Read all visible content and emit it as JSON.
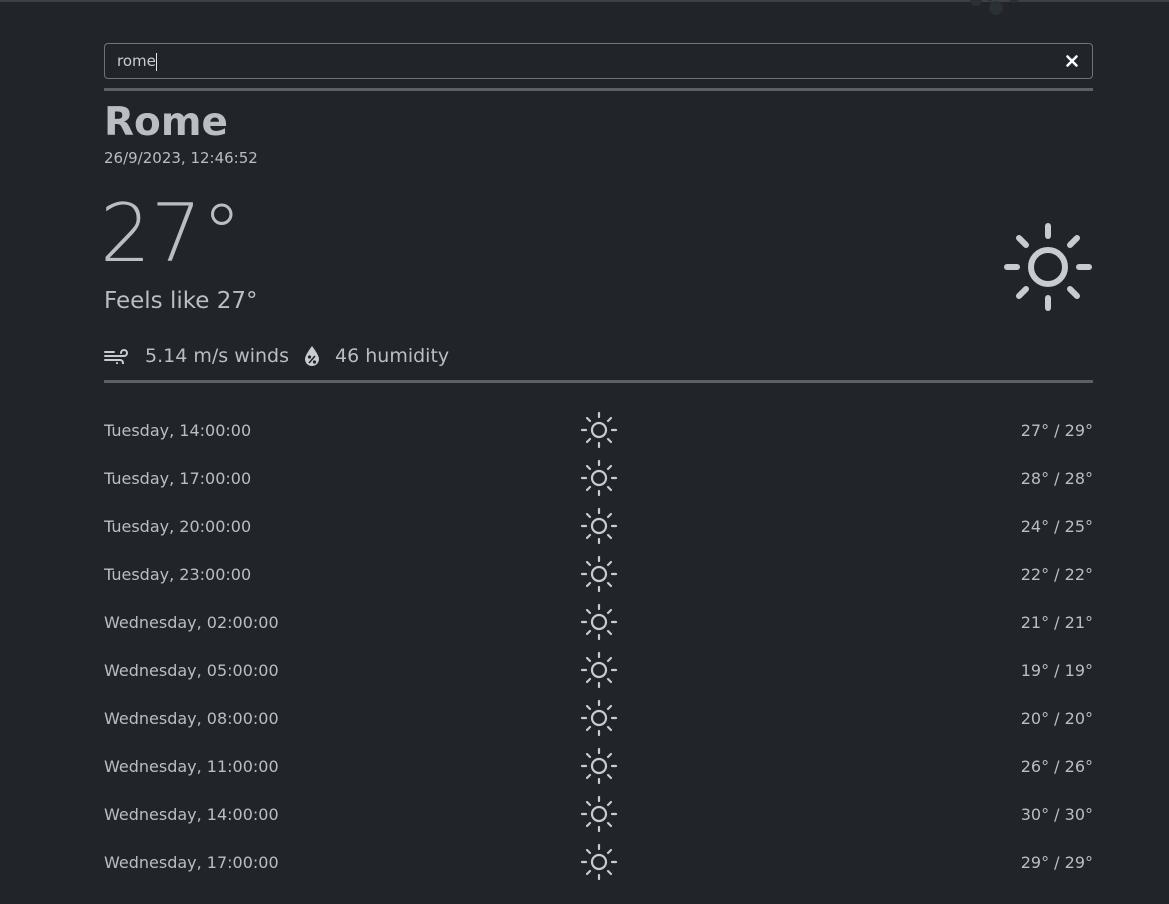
{
  "search": {
    "value": "rome",
    "clear_icon": "close-icon"
  },
  "current": {
    "city": "Rome",
    "datetime": "26/9/2023, 12:46:52",
    "temperature": "27°",
    "feels_like": "Feels like 27°",
    "condition_icon": "sun-icon",
    "wind": "5.14 m/s winds",
    "humidity": "46 humidity"
  },
  "forecast": [
    {
      "when": "Tuesday, 14:00:00",
      "temps": "27° / 29°",
      "icon": "sun-icon"
    },
    {
      "when": "Tuesday, 17:00:00",
      "temps": "28° / 28°",
      "icon": "sun-icon"
    },
    {
      "when": "Tuesday, 20:00:00",
      "temps": "24° / 25°",
      "icon": "sun-icon"
    },
    {
      "when": "Tuesday, 23:00:00",
      "temps": "22° / 22°",
      "icon": "sun-icon"
    },
    {
      "when": "Wednesday, 02:00:00",
      "temps": "21° / 21°",
      "icon": "sun-icon"
    },
    {
      "when": "Wednesday, 05:00:00",
      "temps": "19° / 19°",
      "icon": "sun-icon"
    },
    {
      "when": "Wednesday, 08:00:00",
      "temps": "20° / 20°",
      "icon": "sun-icon"
    },
    {
      "when": "Wednesday, 11:00:00",
      "temps": "26° / 26°",
      "icon": "sun-icon"
    },
    {
      "when": "Wednesday, 14:00:00",
      "temps": "30° / 30°",
      "icon": "sun-icon"
    },
    {
      "when": "Wednesday, 17:00:00",
      "temps": "29° / 29°",
      "icon": "sun-icon"
    }
  ],
  "colors": {
    "background": "#212529",
    "text": "#b9bec3",
    "divider": "#5a6066"
  }
}
